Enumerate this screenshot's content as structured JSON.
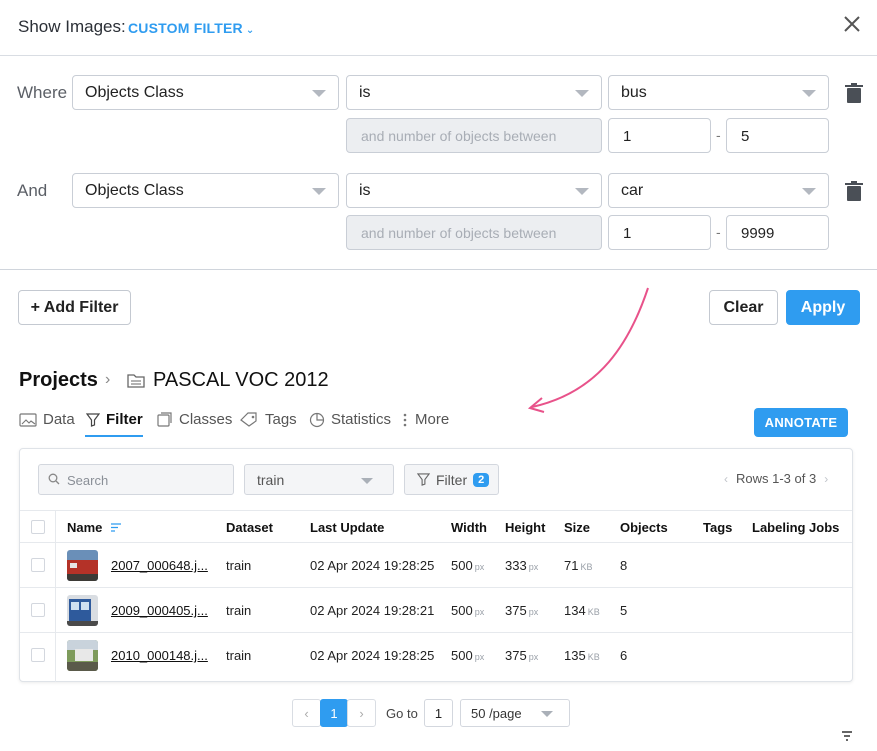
{
  "header": {
    "title": "Show Images:",
    "filter_mode": "CUSTOM FILTER"
  },
  "filters": [
    {
      "connector": "Where",
      "field": "Objects Class",
      "operator": "is",
      "value": "bus",
      "count_placeholder": "and number of objects between",
      "min": "1",
      "max": "5"
    },
    {
      "connector": "And",
      "field": "Objects Class",
      "operator": "is",
      "value": "car",
      "count_placeholder": "and number of objects between",
      "min": "1",
      "max": "9999"
    }
  ],
  "actions": {
    "add_filter": "+ Add Filter",
    "clear": "Clear",
    "apply": "Apply"
  },
  "project": {
    "breadcrumb_root": "Projects",
    "name": "PASCAL VOC 2012"
  },
  "tabs": [
    {
      "label": "Data",
      "icon": "image-folder-icon"
    },
    {
      "label": "Filter",
      "icon": "filter-icon",
      "active": true
    },
    {
      "label": "Classes",
      "icon": "classes-icon"
    },
    {
      "label": "Tags",
      "icon": "tag-icon"
    },
    {
      "label": "Statistics",
      "icon": "pie-chart-icon"
    },
    {
      "label": "More",
      "icon": "more-vertical-icon"
    }
  ],
  "annotate_label": "ANNOTATE",
  "toolbar": {
    "search_placeholder": "Search",
    "dataset": "train",
    "filter_label": "Filter",
    "filter_count": "2",
    "rows_info": "Rows 1-3 of 3"
  },
  "table": {
    "columns": [
      "Name",
      "Dataset",
      "Last Update",
      "Width",
      "Height",
      "Size",
      "Objects",
      "Tags",
      "Labeling Jobs"
    ],
    "rows": [
      {
        "name": "2007_000648.j...",
        "dataset": "train",
        "updated": "02 Apr 2024 19:28:25",
        "width": "500",
        "width_unit": "px",
        "height": "333",
        "height_unit": "px",
        "size": "71",
        "size_unit": "KB",
        "objects": "8"
      },
      {
        "name": "2009_000405.j...",
        "dataset": "train",
        "updated": "02 Apr 2024 19:28:21",
        "width": "500",
        "width_unit": "px",
        "height": "375",
        "height_unit": "px",
        "size": "134",
        "size_unit": "KB",
        "objects": "5"
      },
      {
        "name": "2010_000148.j...",
        "dataset": "train",
        "updated": "02 Apr 2024 19:28:25",
        "width": "500",
        "width_unit": "px",
        "height": "375",
        "height_unit": "px",
        "size": "135",
        "size_unit": "KB",
        "objects": "6"
      }
    ]
  },
  "pagination": {
    "current_page": "1",
    "goto_label": "Go to",
    "goto_value": "1",
    "per_page": "50 /page"
  },
  "colors": {
    "accent": "#2f9cf0",
    "annotation_arrow": "#e8528a"
  }
}
